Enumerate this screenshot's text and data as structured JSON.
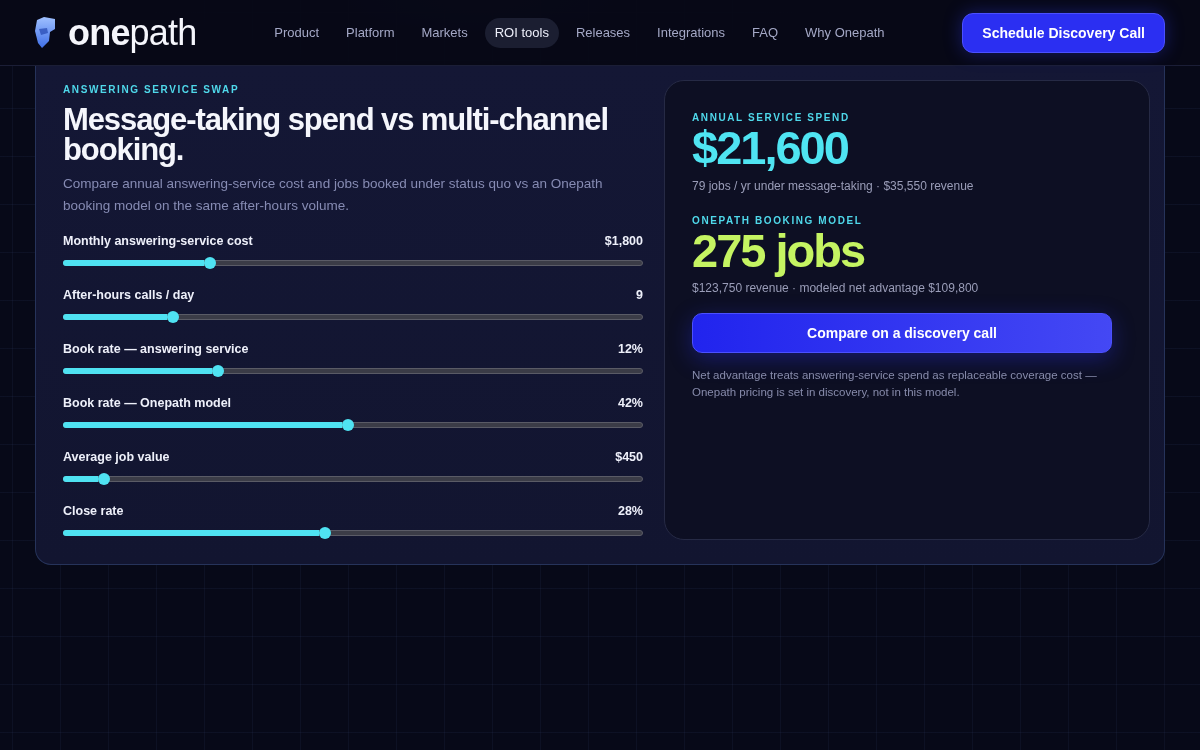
{
  "header": {
    "logo": "**one**path",
    "nav": [
      {
        "label": "Product",
        "selected": false
      },
      {
        "label": "Platform",
        "selected": false
      },
      {
        "label": "Markets",
        "selected": false
      },
      {
        "label": "ROI tools",
        "selected": true
      },
      {
        "label": "Releases",
        "selected": false
      },
      {
        "label": "Integrations",
        "selected": false
      },
      {
        "label": "FAQ",
        "selected": false
      },
      {
        "label": "Why Onepath",
        "selected": false
      }
    ],
    "cta": "Schedule Discovery Call"
  },
  "calculator": {
    "eyebrow": "ANSWERING SERVICE SWAP",
    "title": "Message-taking spend vs multi-channel booking.",
    "description": "Compare annual answering-service cost and jobs booked under status quo vs an Onepath booking model on the same after-hours volume.",
    "sliders": [
      {
        "label": "Monthly answering-service cost",
        "reading": "$1,800",
        "level": 0.254
      },
      {
        "label": "After-hours calls / day",
        "reading": "9",
        "level": 0.19
      },
      {
        "label": "Book rate — answering service",
        "reading": "12%",
        "level": 0.268
      },
      {
        "label": "Book rate — Onepath model",
        "reading": "42%",
        "level": 0.491
      },
      {
        "label": "Average job value",
        "reading": "$450",
        "level": 0.071
      },
      {
        "label": "Close rate",
        "reading": "28%",
        "level": 0.452
      }
    ]
  },
  "results": {
    "metrics": [
      {
        "label": "ANNUAL SERVICE SPEND",
        "value": "$21,600",
        "detail": "79 jobs / yr under message-taking · $35,550 revenue",
        "color": "#4fe4f2"
      },
      {
        "label": "ONEPATH BOOKING MODEL",
        "value": "275 jobs",
        "detail": "$123,750 revenue · modeled net advantage $109,800",
        "color": "#c5f462"
      }
    ],
    "button": "Compare on a discovery call",
    "note": "Net advantage treats answering-service spend as replaceable coverage cost — Onepath pricing is set in discovery, not in this model."
  }
}
